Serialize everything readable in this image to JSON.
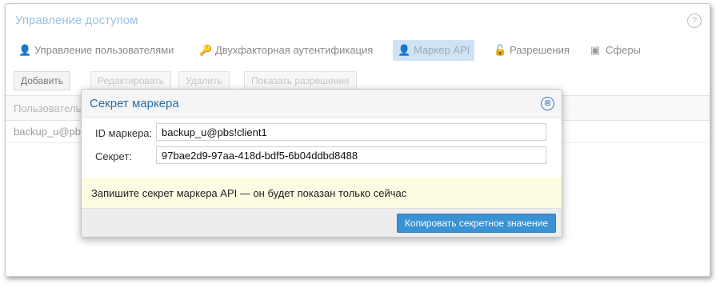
{
  "panel": {
    "title": "Управление доступом",
    "help_icon": "?"
  },
  "tabs": [
    {
      "label": "Управление пользователями",
      "icon": "user-icon",
      "glyph": "👤",
      "active": false
    },
    {
      "label": "Двухфакторная аутентификация",
      "icon": "key-icon",
      "glyph": "🔑",
      "active": false
    },
    {
      "label": "Маркер API",
      "icon": "user-outline-icon",
      "glyph": "👤",
      "active": true
    },
    {
      "label": "Разрешения",
      "icon": "unlock-icon",
      "glyph": "🔓",
      "active": false
    },
    {
      "label": "Сферы",
      "icon": "address-book-icon",
      "glyph": "▣",
      "active": false
    }
  ],
  "toolbar": {
    "add_label": "Добавить",
    "edit_label": "Редактировать",
    "delete_label": "Удалить",
    "show_permissions_label": "Показать разрешения"
  },
  "grid": {
    "header_user": "Пользователь",
    "row_user": "backup_u@pbs"
  },
  "dialog": {
    "title": "Секрет маркера",
    "close_icon": "⊗",
    "token_id_label": "ID маркера:",
    "token_id_value": "backup_u@pbs!client1",
    "secret_label": "Секрет:",
    "secret_value": "97bae2d9-97aa-418d-bdf5-6b04ddbd8488",
    "notice": "Запишите секрет маркера API — он будет показан только сейчас",
    "copy_button": "Копировать секретное значение"
  },
  "colors": {
    "accent": "#3892d3",
    "dialog_title": "#2a6fa8",
    "notice_bg": "#fdfbe1",
    "active_tab_bg": "#cfe3f5"
  }
}
